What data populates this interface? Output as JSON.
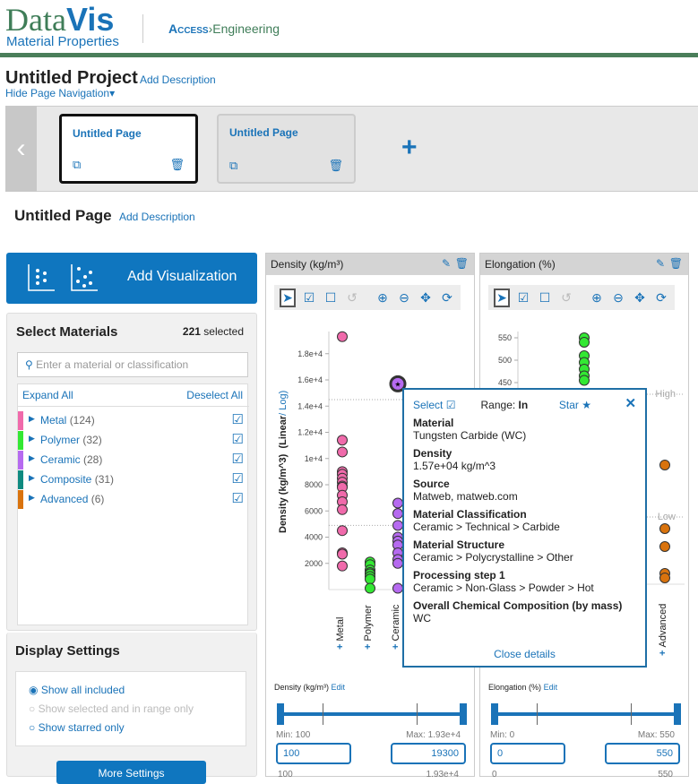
{
  "header": {
    "logo_data": "Data",
    "logo_vis": "Vis",
    "logo_sub": "Material Properties",
    "partner_access": "Access",
    "partner_eng": "Engineering"
  },
  "project": {
    "title": "Untitled Project",
    "add_description": "Add Description",
    "hide_nav": "Hide Page Navigation▾"
  },
  "pages": [
    {
      "title": "Untitled Page",
      "active": true
    },
    {
      "title": "Untitled Page",
      "active": false
    }
  ],
  "page": {
    "title": "Untitled Page",
    "add_description": "Add Description"
  },
  "add_visualization": "Add Visualization",
  "materials": {
    "title": "Select Materials",
    "count": "221",
    "count_label": "selected",
    "search_placeholder": "Enter a material or classification",
    "expand_all": "Expand All",
    "deselect_all": "Deselect All",
    "items": [
      {
        "label": "Metal",
        "count": "(124)",
        "color": "#f06aab",
        "checked": true
      },
      {
        "label": "Polymer",
        "count": "(32)",
        "color": "#33e833",
        "checked": true
      },
      {
        "label": "Ceramic",
        "count": "(28)",
        "color": "#b66af0",
        "checked": true
      },
      {
        "label": "Composite",
        "count": "(31)",
        "color": "#0f8a80",
        "checked": true
      },
      {
        "label": "Advanced",
        "count": "(6)",
        "color": "#d9730d",
        "checked": true
      }
    ]
  },
  "display": {
    "title": "Display Settings",
    "options": [
      {
        "label": "Show all included",
        "selected": true,
        "enabled": true
      },
      {
        "label": "Show selected and in range only",
        "selected": false,
        "enabled": false
      },
      {
        "label": "Show starred only",
        "selected": false,
        "enabled": true
      }
    ],
    "more": "More Settings"
  },
  "chart_data": [
    {
      "type": "scatter",
      "title": "Density (kg/m³)",
      "ylabel": "Density (kg/m^3)",
      "scale_linear": "(Linear",
      "scale_log": "/ Log)",
      "ylim": [
        0,
        19800
      ],
      "yticks": [
        "2000",
        "4000",
        "6000",
        "8000",
        "1e+4",
        "1.2e+4",
        "1.4e+4",
        "1.6e+4",
        "1.8e+4"
      ],
      "ytick_values": [
        2000,
        4000,
        6000,
        8000,
        10000,
        12000,
        14000,
        16000,
        18000
      ],
      "range_high": 14500,
      "range_low": 4900,
      "categories": [
        "Metal",
        "Polymer",
        "Ceramic"
      ],
      "series": [
        {
          "category": "Metal",
          "color": "#f06aab",
          "values": [
            19300,
            11400,
            10500,
            9000,
            8800,
            8500,
            8200,
            7900,
            7800,
            7200,
            6700,
            6100,
            4500,
            2800,
            2700,
            1800
          ]
        },
        {
          "category": "Polymer",
          "color": "#33e833",
          "values": [
            2100,
            1900,
            1500,
            1300,
            1200,
            1000,
            800,
            100
          ]
        },
        {
          "category": "Ceramic",
          "color": "#b66af0",
          "values": [
            15700,
            6600,
            5800,
            4900,
            4000,
            3700,
            3400,
            2800,
            2300,
            2000,
            100
          ],
          "starred": 15700
        }
      ]
    },
    {
      "type": "scatter",
      "title": "Elongation (%)",
      "ylim": [
        0,
        570
      ],
      "yticks": [
        "450",
        "500",
        "550"
      ],
      "ytick_values": [
        450,
        500,
        550
      ],
      "range_high": 424,
      "range_low": 150,
      "range_high_label": "High",
      "range_low_label": "Low",
      "categories": [
        "Polymer",
        "Advanced"
      ],
      "series": [
        {
          "category": "Polymer",
          "color": "#33e833",
          "values": [
            550,
            540,
            510,
            495,
            480,
            465,
            455
          ]
        },
        {
          "category": "Advanced",
          "color": "#d9730d",
          "values": [
            266,
            124,
            84,
            24,
            14
          ]
        }
      ]
    }
  ],
  "sliders": [
    {
      "label": "Density (kg/m³)",
      "edit": "Edit",
      "min_label": "Min: 100",
      "max_label": "Max: 1.93e+4",
      "min_value": "100",
      "max_value": "19300",
      "foot_min": "100",
      "foot_max": "1.93e+4"
    },
    {
      "label": "Elongation (%)",
      "edit": "Edit",
      "min_label": "Min: 0",
      "max_label": "Max: 550",
      "min_value": "0",
      "max_value": "550",
      "foot_min": "0",
      "foot_max": "550"
    }
  ],
  "popup": {
    "select": "Select",
    "range_label": "Range:",
    "range_value": "In",
    "star": "Star",
    "close_details": "Close details",
    "fields": [
      {
        "k": "Material",
        "v": "Tungsten Carbide (WC)"
      },
      {
        "k": "Density",
        "v": "1.57e+04 kg/m^3"
      },
      {
        "k": "Source",
        "v": "Matweb, matweb.com"
      },
      {
        "k": "Material Classification",
        "v": "Ceramic > Technical > Carbide"
      },
      {
        "k": "Material Structure",
        "v": "Ceramic > Polycrystalline > Other"
      },
      {
        "k": "Processing step 1",
        "v": "Ceramic > Non-Glass > Powder > Hot"
      },
      {
        "k": "Overall Chemical Composition (by mass)",
        "v": "WC"
      }
    ]
  },
  "colors": {
    "accent": "#1a73b8",
    "brand_green": "#3f7d58"
  }
}
